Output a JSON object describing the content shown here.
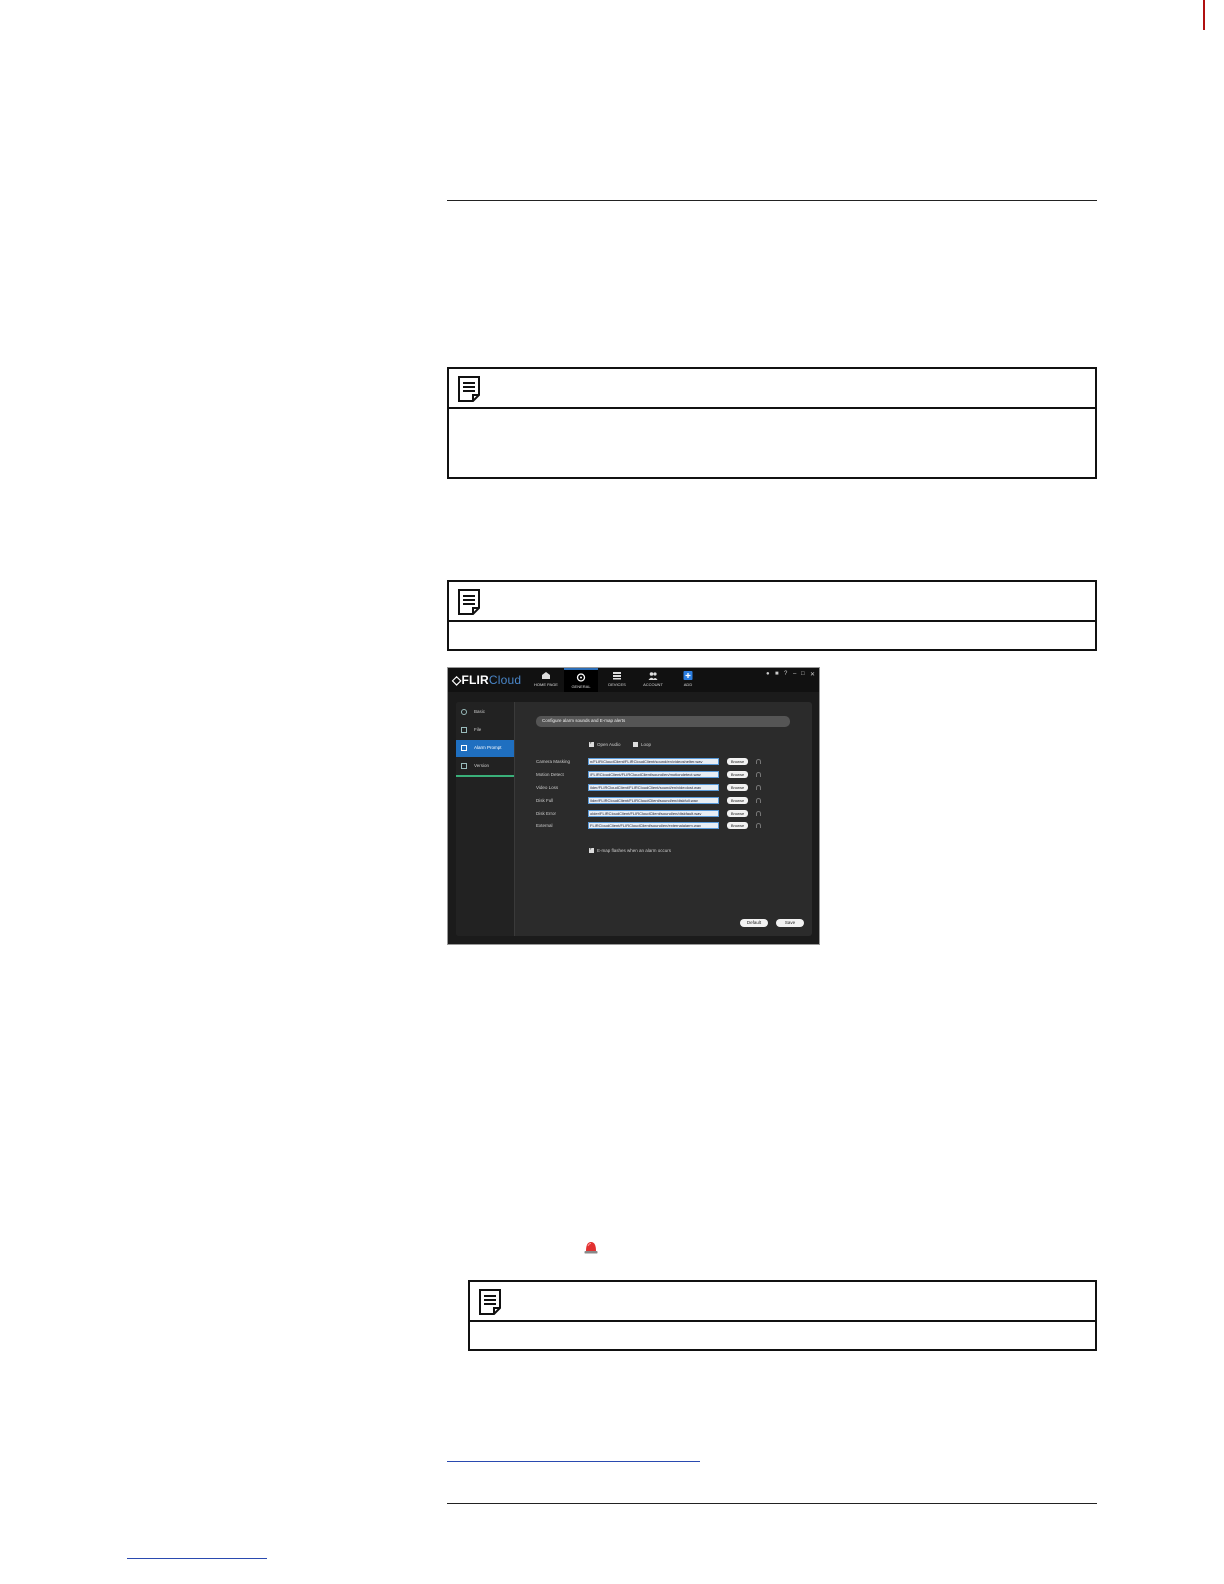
{
  "app": {
    "logo_main": "FLIR",
    "logo_cloud": "Cloud",
    "nav": [
      {
        "label": "HOME PAGE",
        "icon": "home-icon"
      },
      {
        "label": "GENERAL",
        "icon": "gear-icon"
      },
      {
        "label": "DEVICES",
        "icon": "server-icon"
      },
      {
        "label": "ACCOUNT",
        "icon": "users-icon"
      },
      {
        "label": "ADD",
        "icon": "plus-icon"
      }
    ],
    "window_controls": [
      "user-icon",
      "lock-icon",
      "help-icon",
      "minimize-icon",
      "maximize-icon",
      "close-icon"
    ],
    "sidebar": [
      {
        "label": "Basic",
        "icon": "settings-icon"
      },
      {
        "label": "File",
        "icon": "image-icon"
      },
      {
        "label": "Alarm Prompt",
        "icon": "warning-icon"
      },
      {
        "label": "Version",
        "icon": "info-icon"
      }
    ],
    "header": "Configure alarm sounds and E-map alerts",
    "open_audio_label": "Open Audio",
    "loop_label": "Loop",
    "rows": [
      {
        "label": "Camera Masking",
        "path": "n/FLIR/CloudClient/FLIRCloudClient/sound/en/videoshelter.wav"
      },
      {
        "label": "Motion Detect",
        "path": "/FLIRCloudClient/FLIRCloudClient/sound/en/motiondetect.wav"
      },
      {
        "label": "Video Loss",
        "path": "ilder/FLIRCloudClient/FLIRCloudClient/sound/en/videolost.wav"
      },
      {
        "label": "Disk Full",
        "path": "\\lder/FLIRCloudClient/FLIRCloudClient/sound/en/diskfull.wav"
      },
      {
        "label": "Disk Error",
        "path": "older/FLIRCloudClient/FLIRCloudClient/sound/en/diskfault.wav"
      },
      {
        "label": "External",
        "path": "FLIRCloudClient/FLIRCloudClient/sound/en/externalalarm.wav"
      }
    ],
    "browse_label": "Browse",
    "flash_label": "E-map flashes when an alarm occurs",
    "default_label": "Default",
    "save_label": "Save"
  }
}
